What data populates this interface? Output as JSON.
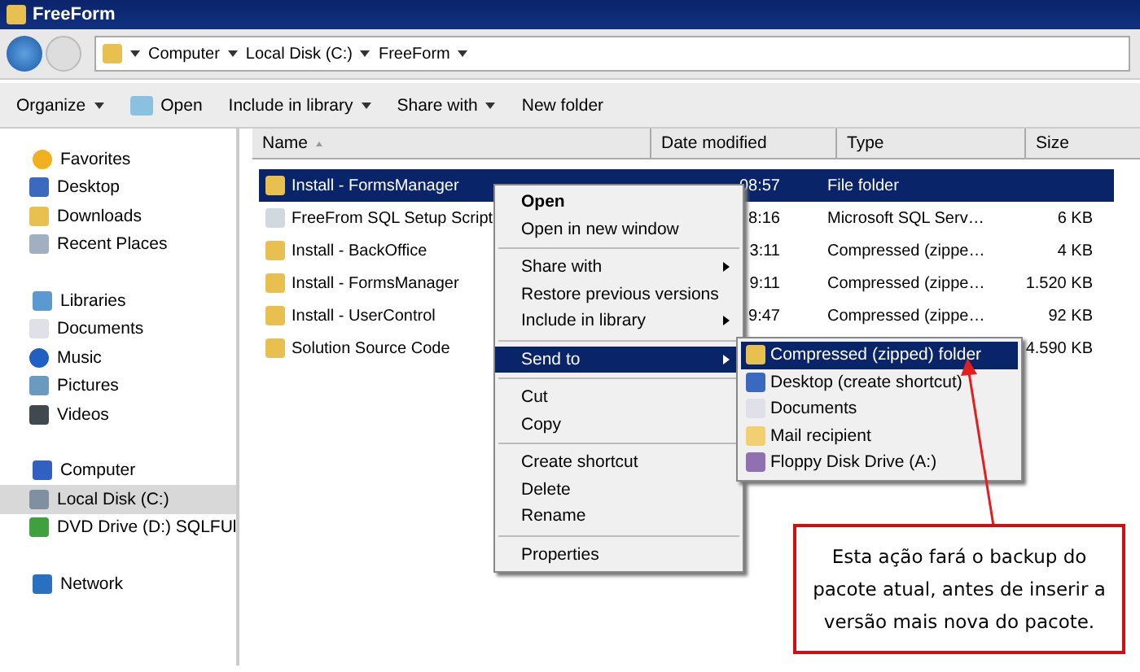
{
  "window": {
    "title": "FreeForm"
  },
  "breadcrumb": [
    "Computer",
    "Local Disk (C:)",
    "FreeForm"
  ],
  "toolbar": [
    {
      "label": "Organize",
      "dropdown": true,
      "icon": false
    },
    {
      "label": "Open",
      "dropdown": false,
      "icon": true
    },
    {
      "label": "Include in library",
      "dropdown": true,
      "icon": false
    },
    {
      "label": "Share with",
      "dropdown": true,
      "icon": false
    },
    {
      "label": "New folder",
      "dropdown": false,
      "icon": false
    }
  ],
  "sidebar": {
    "groups": [
      {
        "label": "Favorites",
        "kind": "star",
        "children": [
          {
            "label": "Desktop",
            "kind": "desktop",
            "selected": false
          },
          {
            "label": "Downloads",
            "kind": "folder",
            "selected": false
          },
          {
            "label": "Recent Places",
            "kind": "recent",
            "selected": false
          }
        ]
      },
      {
        "label": "Libraries",
        "kind": "library",
        "children": [
          {
            "label": "Documents",
            "kind": "doc",
            "selected": false
          },
          {
            "label": "Music",
            "kind": "music",
            "selected": false
          },
          {
            "label": "Pictures",
            "kind": "picture",
            "selected": false
          },
          {
            "label": "Videos",
            "kind": "video",
            "selected": false
          }
        ]
      },
      {
        "label": "Computer",
        "kind": "computer",
        "children": [
          {
            "label": "Local Disk (C:)",
            "kind": "disk",
            "selected": true
          },
          {
            "label": "DVD Drive (D:) SQLFUl",
            "kind": "dvd",
            "selected": false
          }
        ]
      },
      {
        "label": "Network",
        "kind": "network"
      }
    ]
  },
  "table": {
    "columns": [
      "Name",
      "Date modified",
      "Type",
      "Size"
    ],
    "rows": [
      {
        "name": "Install - FormsManager",
        "date": "08:57",
        "type": "File folder",
        "size": "",
        "kind": "folder",
        "selected": true
      },
      {
        "name": "FreeFrom SQL Setup Script",
        "date": "8:16",
        "type": "Microsoft SQL Serv…",
        "size": "6 KB",
        "kind": "script",
        "selected": false
      },
      {
        "name": "Install - BackOffice",
        "date": "3:11",
        "type": "Compressed (zippe…",
        "size": "4 KB",
        "kind": "zip",
        "selected": false
      },
      {
        "name": "Install - FormsManager",
        "date": "9:11",
        "type": "Compressed (zippe…",
        "size": "1.520 KB",
        "kind": "zip",
        "selected": false
      },
      {
        "name": "Install - UserControl",
        "date": "9:47",
        "type": "Compressed (zippe…",
        "size": "92 KB",
        "kind": "zip",
        "selected": false
      },
      {
        "name": "Solution Source Code",
        "date": "",
        "type": "",
        "size": "4.590 KB",
        "kind": "zip",
        "selected": false
      }
    ]
  },
  "context_menu": {
    "groups": [
      [
        {
          "label": "Open",
          "bold": true,
          "submenu": false,
          "selected": false
        },
        {
          "label": "Open in new window",
          "bold": false,
          "submenu": false,
          "selected": false
        }
      ],
      [
        {
          "label": "Share with",
          "bold": false,
          "submenu": true,
          "selected": false
        },
        {
          "label": "Restore previous versions",
          "bold": false,
          "submenu": false,
          "selected": false
        },
        {
          "label": "Include in library",
          "bold": false,
          "submenu": true,
          "selected": false
        }
      ],
      [
        {
          "label": "Send to",
          "bold": false,
          "submenu": true,
          "selected": true
        }
      ],
      [
        {
          "label": "Cut",
          "bold": false,
          "submenu": false,
          "selected": false
        },
        {
          "label": "Copy",
          "bold": false,
          "submenu": false,
          "selected": false
        }
      ],
      [
        {
          "label": "Create shortcut",
          "bold": false,
          "submenu": false,
          "selected": false
        },
        {
          "label": "Delete",
          "bold": false,
          "submenu": false,
          "selected": false
        },
        {
          "label": "Rename",
          "bold": false,
          "submenu": false,
          "selected": false
        }
      ],
      [
        {
          "label": "Properties",
          "bold": false,
          "submenu": false,
          "selected": false
        }
      ]
    ]
  },
  "submenu": {
    "items": [
      {
        "label": "Compressed (zipped) folder",
        "kind": "zip",
        "selected": true
      },
      {
        "label": "Desktop (create shortcut)",
        "kind": "desktop",
        "selected": false
      },
      {
        "label": "Documents",
        "kind": "doc",
        "selected": false
      },
      {
        "label": "Mail recipient",
        "kind": "mail",
        "selected": false
      },
      {
        "label": "Floppy Disk Drive (A:)",
        "kind": "floppy",
        "selected": false
      }
    ]
  },
  "callout": {
    "text": "Esta ação fará o backup do pacote atual, antes de inserir a versão mais nova do pacote."
  }
}
